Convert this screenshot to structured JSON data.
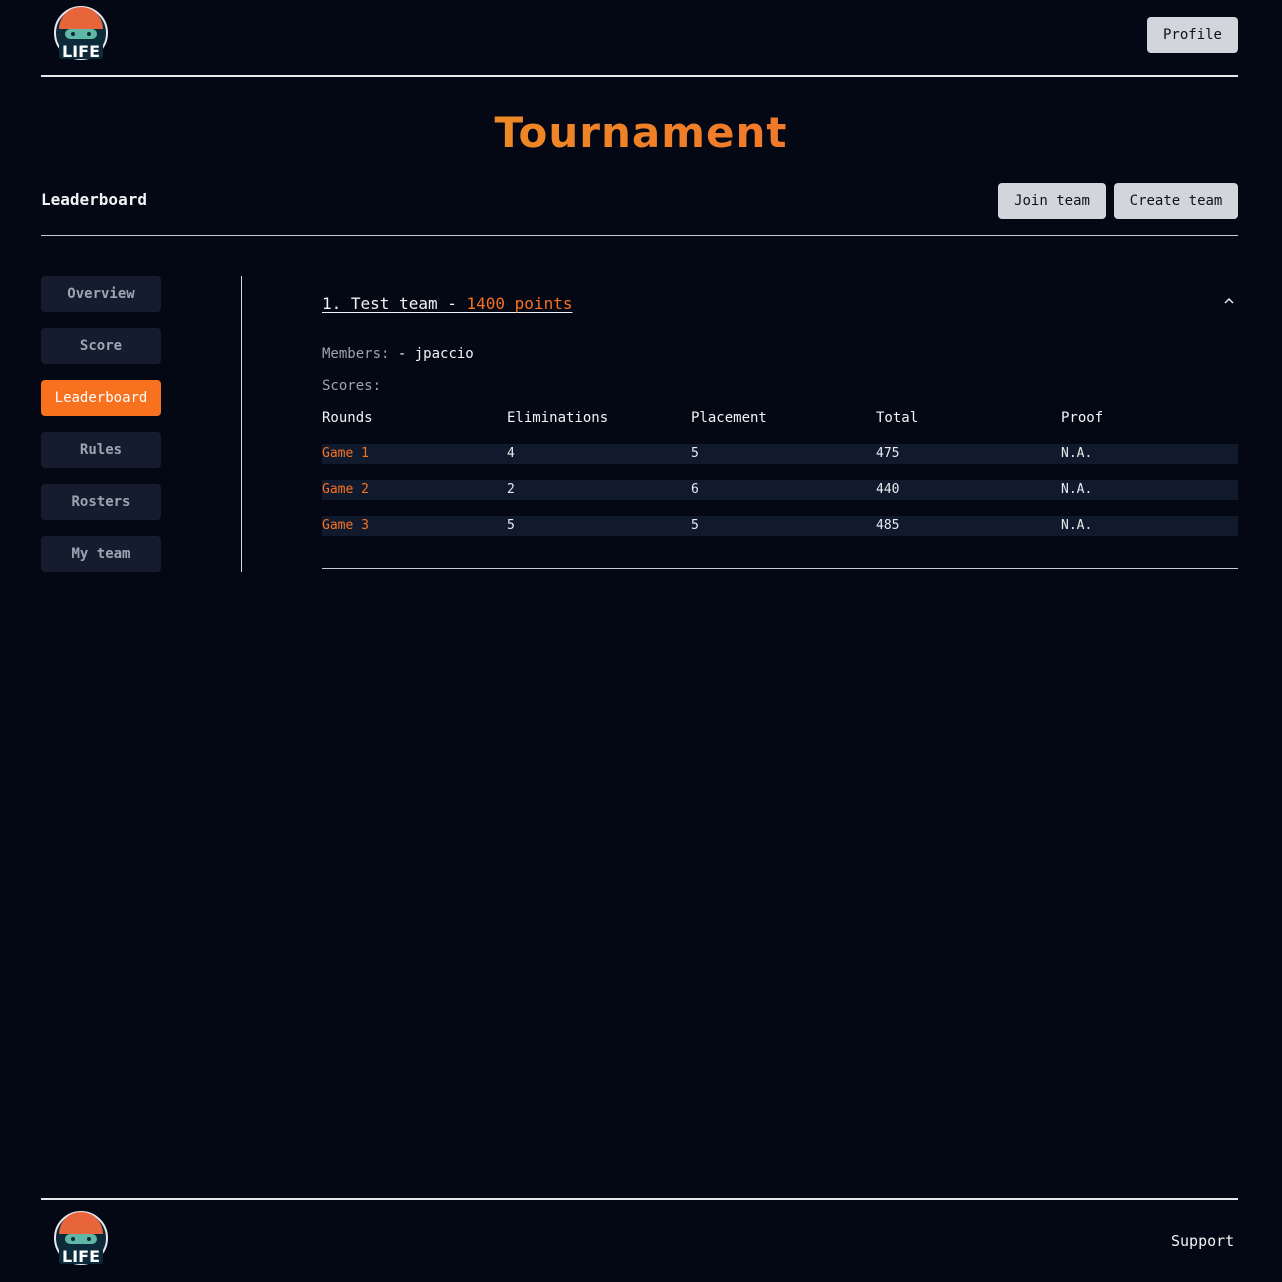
{
  "header": {
    "profile_label": "Profile",
    "logo_text": "LIFE"
  },
  "page": {
    "title": "Tournament"
  },
  "toolbar": {
    "section_title": "Leaderboard",
    "join_label": "Join team",
    "create_label": "Create team"
  },
  "sidebar": {
    "items": [
      {
        "label": "Overview",
        "active": false
      },
      {
        "label": "Score",
        "active": false
      },
      {
        "label": "Leaderboard",
        "active": true
      },
      {
        "label": "Rules",
        "active": false
      },
      {
        "label": "Rosters",
        "active": false
      },
      {
        "label": "My team",
        "active": false
      }
    ]
  },
  "leaderboard": {
    "entry": {
      "title_prefix": "1. Test team - ",
      "points": "1400 points",
      "members_label": "Members:",
      "members": "- jpaccio",
      "scores_label": "Scores:",
      "columns": [
        "Rounds",
        "Eliminations",
        "Placement",
        "Total",
        "Proof"
      ],
      "rows": [
        [
          "Game 1",
          "4",
          "5",
          "475",
          "N.A."
        ],
        [
          "Game 2",
          "2",
          "6",
          "440",
          "N.A."
        ],
        [
          "Game 3",
          "5",
          "5",
          "485",
          "N.A."
        ]
      ]
    }
  },
  "footer": {
    "support_label": "Support",
    "logo_text": "LIFE"
  },
  "colors": {
    "accent": "#f7711f",
    "background": "#040814",
    "panel": "#151c2e"
  }
}
